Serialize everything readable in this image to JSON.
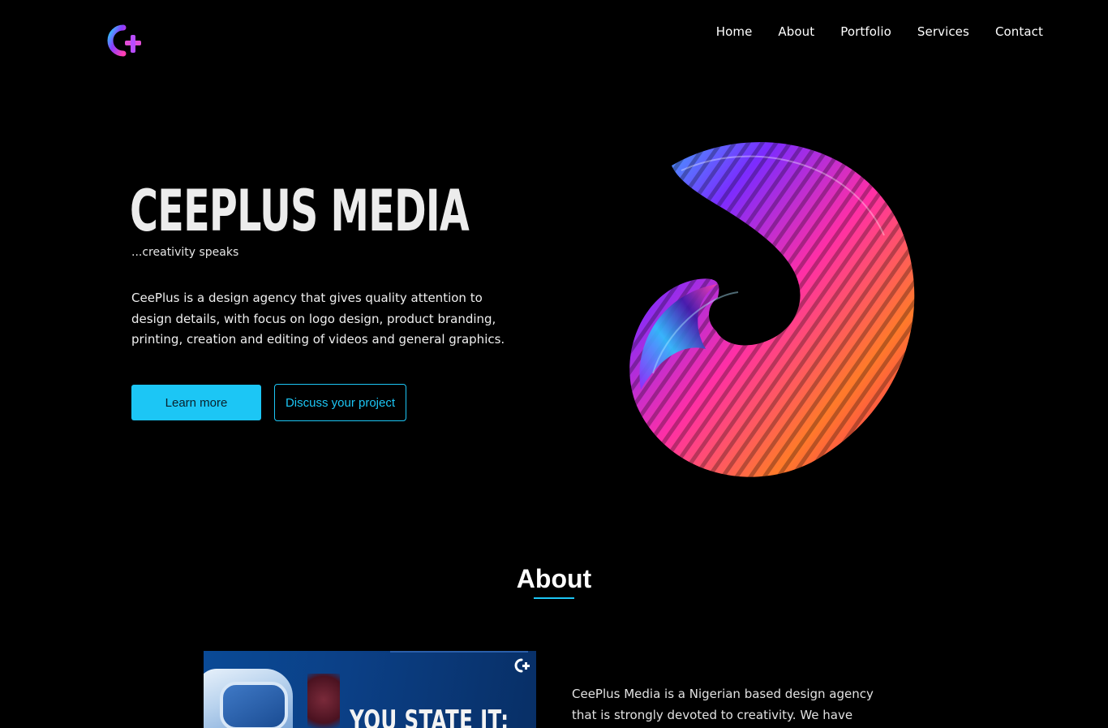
{
  "header": {
    "logo_alt": "CeePlus logo",
    "nav": [
      {
        "label": "Home"
      },
      {
        "label": "About"
      },
      {
        "label": "Portfolio"
      },
      {
        "label": "Services"
      },
      {
        "label": "Contact"
      }
    ]
  },
  "hero": {
    "title": "CEEPLUS MEDIA",
    "tagline": "...creativity speaks",
    "description": "CeePlus is a design agency that gives quality attention to design details, with focus on logo design, product branding, printing, creation and editing of videos and general graphics.",
    "primary_button": "Learn more",
    "secondary_button": "Discuss your project"
  },
  "about": {
    "heading": "About",
    "image_headline": "YOU STATE IT:",
    "text": "CeePlus Media is a Nigerian based design agency that is strongly devoted to creativity. We have"
  },
  "colors": {
    "accent": "#1cc6f5",
    "background": "#000000",
    "text": "#ffffff"
  }
}
